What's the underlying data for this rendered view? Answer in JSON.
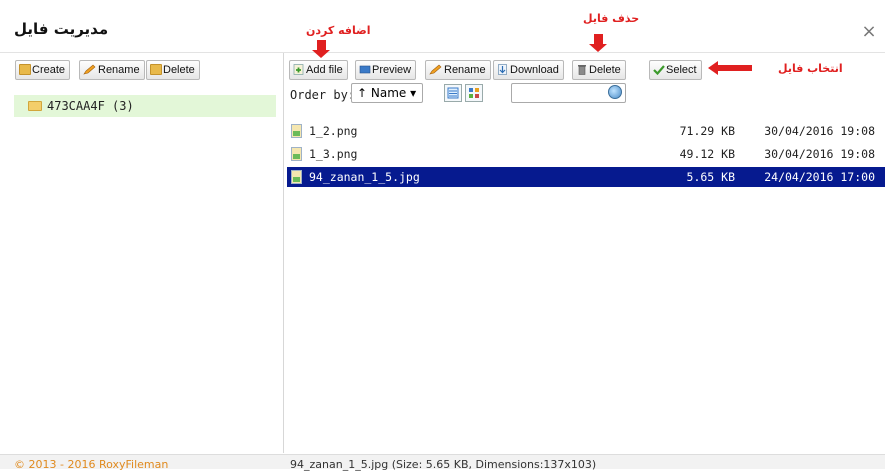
{
  "window": {
    "title": "مدیریت فایل",
    "close_symbol": "×"
  },
  "left_toolbar": {
    "create": "Create",
    "rename": "Rename",
    "delete": "Delete"
  },
  "tree": {
    "folder": "473CAA4F (3)"
  },
  "right_toolbar": {
    "add_file": "Add file",
    "preview": "Preview",
    "rename": "Rename",
    "download": "Download",
    "delete": "Delete",
    "select": "Select"
  },
  "order": {
    "label": "Order by:",
    "value": "↑ Name ▾"
  },
  "search": {
    "value": ""
  },
  "files": [
    {
      "name": "1_2.png",
      "size": "71.29 KB",
      "date": "30/04/2016 19:08",
      "selected": false
    },
    {
      "name": "1_3.png",
      "size": "49.12 KB",
      "date": "30/04/2016 19:08",
      "selected": false
    },
    {
      "name": "94_zanan_1_5.jpg",
      "size": "5.65 KB",
      "date": "24/04/2016 17:00",
      "selected": true
    }
  ],
  "annotations": {
    "add_file": "اضافه کردن",
    "delete_file": "حذف فایل",
    "select_file": "انتخاب فایل"
  },
  "footer": {
    "copyright": "© 2013 - 2016 RoxyFileman",
    "status": "94_zanan_1_5.jpg (Size: 5.65 KB, Dimensions:137x103)"
  },
  "colors": {
    "selected_row": "#061a8f",
    "tree_highlight": "#e3f7d8",
    "annotation": "#e02020",
    "copyright": "#e08a1e"
  }
}
